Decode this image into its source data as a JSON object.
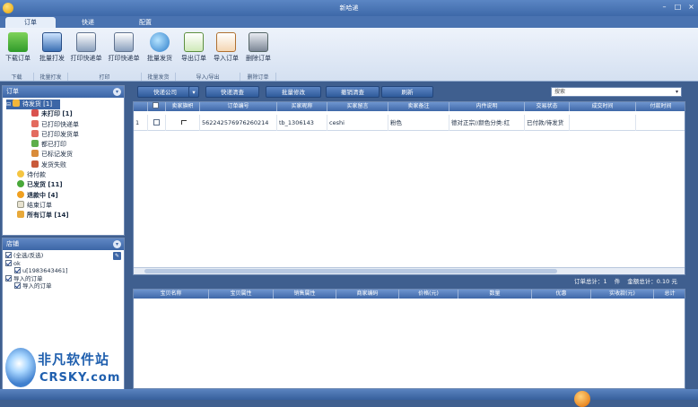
{
  "app": {
    "title": "新哈递"
  },
  "ribbon_tabs": [
    "订单",
    "快递",
    "配置"
  ],
  "ribbon_buttons": [
    {
      "label": "下载订单",
      "icon": "download-icon"
    },
    {
      "label": "批量打发",
      "icon": "tv-icon"
    },
    {
      "label": "打印快递单",
      "icon": "printer-icon"
    },
    {
      "label": "打印快递单",
      "icon": "printer-icon"
    },
    {
      "label": "批量发货",
      "icon": "globe-icon"
    },
    {
      "label": "导出订单",
      "icon": "export-icon"
    },
    {
      "label": "导入订单",
      "icon": "import-icon"
    },
    {
      "label": "删除订单",
      "icon": "trash-icon"
    }
  ],
  "ribbon_groups": [
    "下载",
    "批量打发",
    "打印",
    "批量发货",
    "导入/导出",
    "删除订单"
  ],
  "orders_pane": {
    "title": "订单",
    "tree": [
      {
        "label": "待发货 [1]",
        "level": 0
      },
      {
        "label": "未打印 [1]",
        "level": 1
      },
      {
        "label": "已打印快递单",
        "level": 1
      },
      {
        "label": "已打印发货单",
        "level": 1
      },
      {
        "label": "都已打印",
        "level": 1
      },
      {
        "label": "已标记发货",
        "level": 1
      },
      {
        "label": "发货失败",
        "level": 1
      },
      {
        "label": "待付款",
        "level": 0
      },
      {
        "label": "已发货 [11]",
        "level": 0
      },
      {
        "label": "退款中 [4]",
        "level": 0
      },
      {
        "label": "结束订单",
        "level": 0
      },
      {
        "label": "所有订单 [14]",
        "level": 0
      }
    ]
  },
  "shop_pane": {
    "title": "店铺",
    "items": [
      {
        "label": "(全选/反选)",
        "level": 0
      },
      {
        "label": "ok",
        "level": 0
      },
      {
        "label": "u[1983643461]",
        "level": 1
      },
      {
        "label": "导入的订单",
        "level": 0
      },
      {
        "label": "导入的订单",
        "level": 1
      }
    ]
  },
  "toolbar": {
    "buttons": [
      "快递公司",
      "快递清查",
      "批量修改",
      "撤销清查",
      "刷新"
    ],
    "search_placeholder": "搜索"
  },
  "order_table": {
    "columns": [
      "",
      "",
      "卖家旗帜",
      "订单编号",
      "买家昵称",
      "买家留言",
      "卖家备注",
      "内件说明",
      "交易状态",
      "成交时间",
      "付款时间"
    ],
    "rows": [
      [
        "1",
        "",
        "",
        "562242576976260214",
        "tb_1306143",
        "ceshi",
        "粉色",
        "德对正宗//颜色分类:红",
        "已付款/待发货",
        "",
        ""
      ]
    ]
  },
  "summary": {
    "count_label": "订单总计：1",
    "unit": "件",
    "amount_label": "金额总计：0.10 元"
  },
  "item_table": {
    "columns": [
      "宝贝名称",
      "宝贝属性",
      "销售属性",
      "商家编码",
      "价格(元)",
      "数量",
      "优惠",
      "实收款(元)",
      "总计"
    ]
  },
  "watermark": {
    "cn": "非凡软件站",
    "en": "CRSKY.com"
  },
  "colors": {
    "accent": "#3c66a6",
    "ribbon_bg": "#e6eef9",
    "window_bg": "#3f5f8f"
  }
}
